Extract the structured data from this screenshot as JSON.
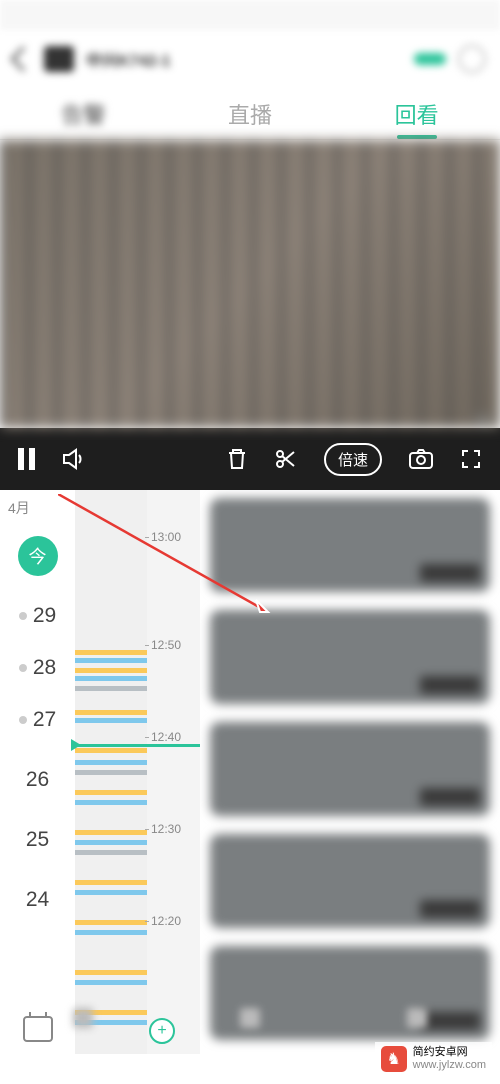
{
  "header": {
    "camera_name": "中兴K742-1"
  },
  "tabs": {
    "t0": "告警",
    "t1": "直播",
    "t2": "回看"
  },
  "controls": {
    "speed": "倍速"
  },
  "timeline": {
    "month": "4月",
    "today": "今",
    "days": [
      "29",
      "28",
      "27",
      "26",
      "25",
      "24"
    ],
    "ticks": [
      "13:00",
      "12:50",
      "12:40",
      "12:30",
      "12:20"
    ]
  },
  "zoom": "+",
  "watermark": {
    "site": "简约安卓网",
    "url": "www.jylzw.com"
  }
}
